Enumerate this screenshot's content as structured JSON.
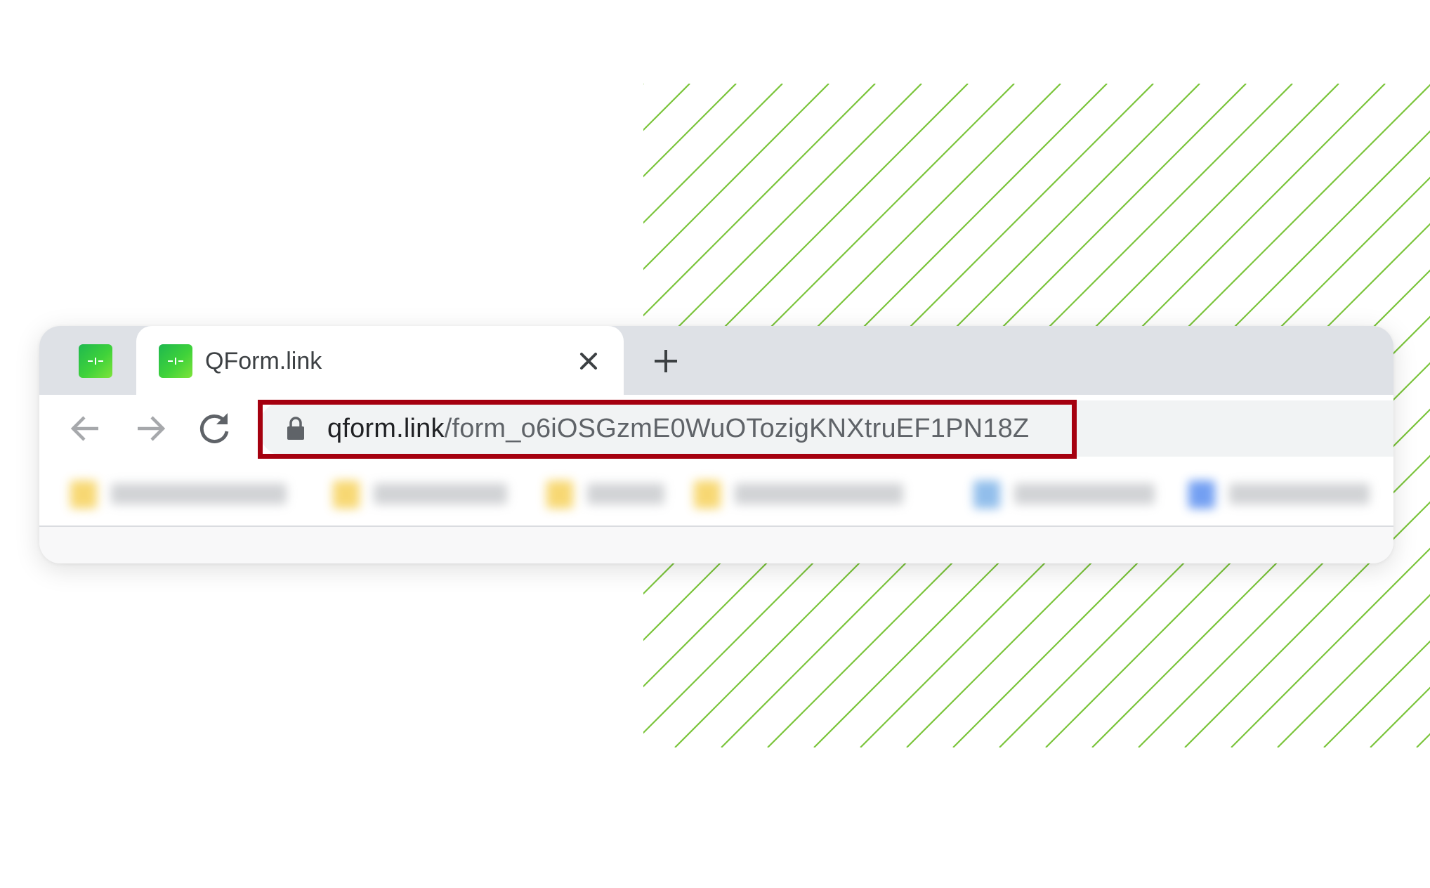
{
  "colors": {
    "hatch_line": "#7ac43a",
    "highlight_border": "#a5000f",
    "tabstrip_bg": "#dee1e6",
    "favicon_gradient": [
      "#1fb84f",
      "#7ee43a"
    ]
  },
  "tabs": {
    "pinned": {
      "icon": "qform-favicon-icon"
    },
    "active": {
      "title": "QForm.link",
      "icon": "qform-favicon-icon"
    },
    "close_icon": "close-icon",
    "new_tab_icon": "plus-icon"
  },
  "toolbar": {
    "back_icon": "arrow-left-icon",
    "forward_icon": "arrow-right-icon",
    "reload_icon": "reload-icon",
    "lock_icon": "lock-icon",
    "url_host": "qform.link",
    "url_path": "/form_o6iOSGzmE0WuOTozigKNXtruEF1PN18Z"
  },
  "bookmarks": {
    "blurred": true,
    "items": [
      {
        "icon": "folder-icon",
        "color": "#f6d15b"
      },
      {
        "icon": "folder-icon",
        "color": "#f6d15b"
      },
      {
        "icon": "folder-icon",
        "color": "#f6d15b"
      },
      {
        "icon": "folder-icon",
        "color": "#f6d15b"
      },
      {
        "icon": "site-icon",
        "color": "#7fb3e8"
      },
      {
        "icon": "site-icon",
        "color": "#5b8ff0"
      }
    ]
  }
}
